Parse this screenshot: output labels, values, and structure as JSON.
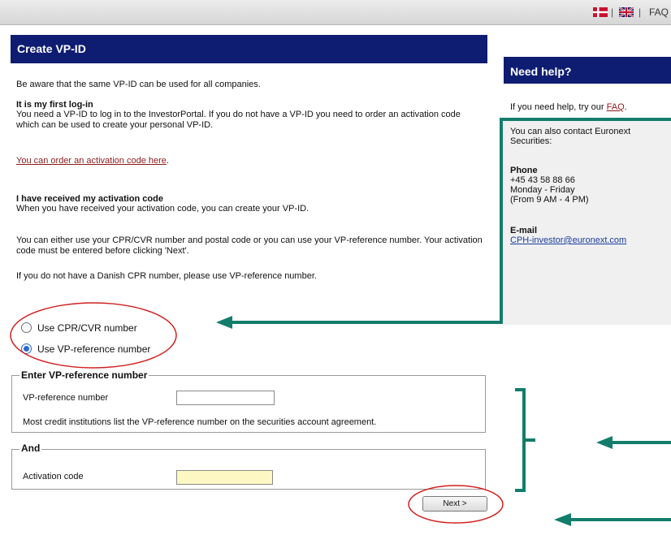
{
  "topbar": {
    "flags": [
      "denmark-flag",
      "uk-flag"
    ],
    "separator": "|",
    "faq_label": "FAQ"
  },
  "main": {
    "title": "Create VP-ID",
    "intro": "Be aware that the same VP-ID can be used for all companies.",
    "first_login_heading": "It is my first log-in",
    "first_login_text": "You need a VP-ID to log in to the InvestorPortal. If you do not have a VP-ID you need to order an activation code which can be used to create your personal VP-ID.",
    "order_link": "You can order an activation code here",
    "order_link_suffix": ".",
    "received_heading": "I have received my activation code",
    "received_text": "When you have received your activation code, you can create your VP-ID.",
    "either_text": "You can either use your CPR/CVR number and postal code or you can use your VP-reference number. Your activation code must be entered before clicking 'Next'.",
    "no_cpr_text": "If you do not have a Danish CPR number, please use VP-reference number."
  },
  "radios": {
    "option_cpr": "Use CPR/CVR number",
    "option_vp": "Use VP-reference number",
    "selected": "vp"
  },
  "vp_section": {
    "legend": "Enter VP-reference number",
    "field_label": "VP-reference number",
    "field_value": "",
    "note": "Most credit institutions list the VP-reference number on the securities account agreement."
  },
  "and_section": {
    "legend": "And",
    "field_label": "Activation code",
    "field_value": ""
  },
  "next_label": "Next >",
  "help": {
    "title": "Need help?",
    "try_text": "If you need help, try our ",
    "faq_link": "FAQ",
    "try_suffix": ".",
    "contact_text": "You can also contact Euronext Securities:",
    "phone_heading": "Phone",
    "phone_number": "+45 43 58 88 66",
    "phone_days": "Monday - Friday",
    "phone_hours": "(From 9 AM - 4 PM)",
    "email_heading": "E-mail",
    "email_link": "CPH-investor@euronext.com"
  },
  "colors": {
    "header_bg": "#0e1d71",
    "annotation_red": "#d32020",
    "annotation_teal": "#137d6b",
    "activation_field_bg": "#fdf7c4"
  }
}
